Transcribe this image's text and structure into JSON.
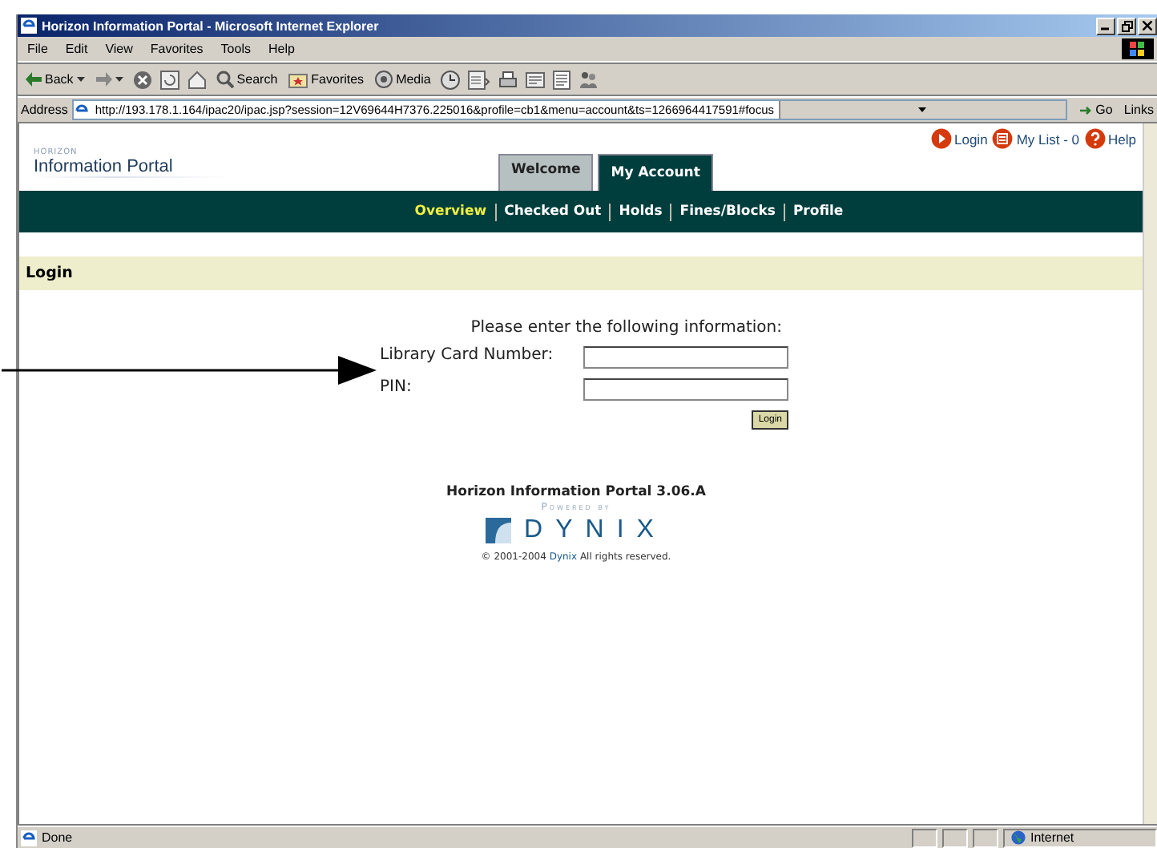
{
  "window": {
    "title": "Horizon Information Portal - Microsoft Internet Explorer"
  },
  "menu_bar": [
    "File",
    "Edit",
    "View",
    "Favorites",
    "Tools",
    "Help"
  ],
  "toolbar": [
    {
      "kind": "back",
      "label": "Back"
    },
    {
      "kind": "forward"
    },
    {
      "kind": "stop"
    },
    {
      "kind": "refresh"
    },
    {
      "kind": "home"
    },
    {
      "kind": "search",
      "label": "Search"
    },
    {
      "kind": "favorites",
      "label": "Favorites"
    },
    {
      "kind": "media",
      "label": "Media"
    },
    {
      "kind": "history"
    },
    {
      "kind": "mail"
    },
    {
      "kind": "print"
    },
    {
      "kind": "edit"
    },
    {
      "kind": "discuss"
    },
    {
      "kind": "messenger"
    }
  ],
  "address_bar": {
    "label": "Address",
    "url": "http://193.178.1.164/ipac20/ipac.jsp?session=12V69644H7376.225016&profile=cb1&menu=account&ts=1266964417591#focus",
    "go": "Go",
    "links": "Links"
  },
  "page": {
    "logo": {
      "small": "HORIZON",
      "name": "Information Portal"
    },
    "top_links": [
      {
        "kind": "login",
        "label": "Login"
      },
      {
        "kind": "list",
        "label": "My List - 0"
      },
      {
        "kind": "help",
        "label": "Help"
      }
    ],
    "tabs": [
      {
        "label": "Welcome",
        "selected": false
      },
      {
        "label": "My Account",
        "selected": true
      }
    ],
    "subnav": [
      {
        "label": "Overview",
        "selected": true
      },
      {
        "label": "Checked Out",
        "selected": false
      },
      {
        "label": "Holds",
        "selected": false
      },
      {
        "label": "Fines/Blocks",
        "selected": false
      },
      {
        "label": "Profile",
        "selected": false
      }
    ],
    "section_title": "Login",
    "form": {
      "prompt": "Please enter the following information:",
      "fields": [
        {
          "label": "Library Card Number:"
        },
        {
          "label": "PIN:"
        }
      ],
      "button": "Login"
    },
    "footer": {
      "product": "Horizon Information Portal 3.06.A",
      "powered": "Powered by",
      "brand": "DYNIX",
      "copyright": {
        "before": "© 2001-2004",
        "link": "Dynix",
        "after": "All rights reserved."
      }
    }
  },
  "status_bar": {
    "text": "Done",
    "zone": "Internet"
  }
}
